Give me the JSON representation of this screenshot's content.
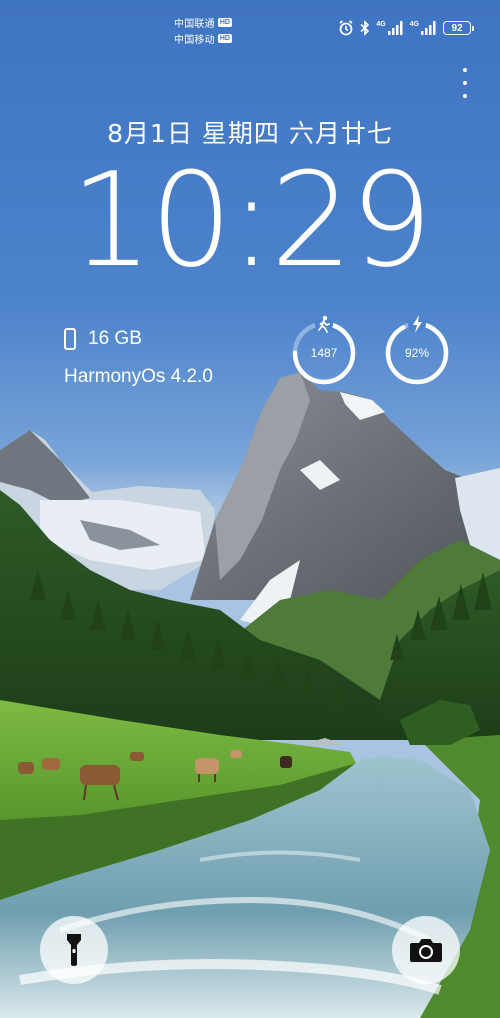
{
  "status_bar": {
    "carrier_1": "中国联通",
    "carrier_2": "中国移动",
    "hd_label": "HD",
    "net_1": "4G",
    "net_2": "4G",
    "battery": "92"
  },
  "lockscreen": {
    "date": "8月1日 星期四 六月廿七",
    "time": "10:29",
    "storage": "16 GB",
    "os_version": "HarmonyOs 4.2.0"
  },
  "widgets": {
    "steps": {
      "value": "1487",
      "icon": "walking-icon",
      "progress": 0.75
    },
    "battery": {
      "value": "92%",
      "icon": "charging-bolt-icon",
      "progress": 0.92
    }
  },
  "shortcuts": {
    "left": "flashlight-icon",
    "right": "camera-icon"
  },
  "colors": {
    "sky": "#4d83cc",
    "ring_track": "#8fb2e0",
    "ring_fill": "#ffffff"
  }
}
